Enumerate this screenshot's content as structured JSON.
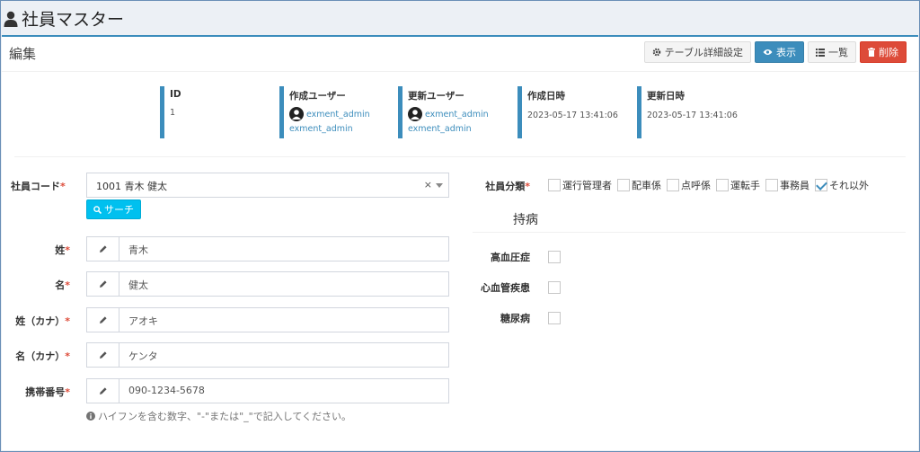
{
  "header": {
    "title": "社員マスター"
  },
  "box": {
    "title": "編集",
    "tools": {
      "table_settings": "テーブル詳細設定",
      "view": "表示",
      "list": "一覧",
      "delete": "削除"
    }
  },
  "meta": {
    "id_label": "ID",
    "id_value": "1",
    "created_user_label": "作成ユーザー",
    "created_user": "exment_admin",
    "created_user_sub": "exment_admin",
    "updated_user_label": "更新ユーザー",
    "updated_user": "exment_admin",
    "updated_user_sub": "exment_admin",
    "created_at_label": "作成日時",
    "created_at": "2023-05-17 13:41:06",
    "updated_at_label": "更新日時",
    "updated_at": "2023-05-17 13:41:06"
  },
  "form": {
    "employee_code_label": "社員コード",
    "employee_code_value": "1001 青木 健太",
    "search_button": "サーチ",
    "last_name_label": "姓",
    "last_name": "青木",
    "first_name_label": "名",
    "first_name": "健太",
    "last_name_kana_label": "姓（カナ）",
    "last_name_kana": "アオキ",
    "first_name_kana_label": "名（カナ）",
    "first_name_kana": "ケンタ",
    "mobile_label": "携帯番号",
    "mobile": "090-1234-5678",
    "mobile_help": "ハイフンを含む数字、\"-\"または\"_\"で記入してください。",
    "required_mark": "*"
  },
  "category": {
    "label": "社員分類",
    "options": [
      {
        "label": "運行管理者",
        "checked": false
      },
      {
        "label": "配車係",
        "checked": false
      },
      {
        "label": "点呼係",
        "checked": false
      },
      {
        "label": "運転手",
        "checked": false
      },
      {
        "label": "事務員",
        "checked": false
      },
      {
        "label": "それ以外",
        "checked": true
      }
    ]
  },
  "disease": {
    "title": "持病",
    "items": [
      {
        "label": "高血圧症",
        "checked": false
      },
      {
        "label": "心血管疾患",
        "checked": false
      },
      {
        "label": "糖尿病",
        "checked": false
      }
    ]
  },
  "colors": {
    "primary": "#3c8dbc",
    "danger": "#dd4b39",
    "info": "#00c0ef"
  }
}
